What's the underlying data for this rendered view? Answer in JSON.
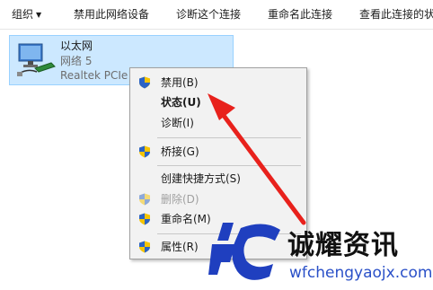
{
  "toolbar": {
    "organize": "组织",
    "disable_device": "禁用此网络设备",
    "diagnose": "诊断这个连接",
    "rename": "重命名此连接",
    "view_status": "查看此连接的状"
  },
  "adapter": {
    "name": "以太网",
    "network": "网络 5",
    "device": "Realtek PCIe"
  },
  "context_menu": {
    "items": [
      {
        "label": "禁用(B)",
        "icon": "uac-shield-icon"
      },
      {
        "label": "状态(U)"
      },
      {
        "label": "诊断(I)"
      },
      {
        "label": "桥接(G)",
        "icon": "uac-shield-icon"
      },
      {
        "label": "创建快捷方式(S)"
      },
      {
        "label": "删除(D)",
        "icon": "uac-shield-icon",
        "disabled": true
      },
      {
        "label": "重命名(M)",
        "icon": "uac-shield-icon"
      },
      {
        "label": "属性(R)",
        "icon": "uac-shield-icon"
      }
    ]
  },
  "watermark": {
    "title": "诚耀资讯",
    "url": "wfchengyaojx.com"
  },
  "colors": {
    "selection": "#cce8ff",
    "arrow": "#e8211c",
    "watermark_blue": "#1f3fbf"
  }
}
